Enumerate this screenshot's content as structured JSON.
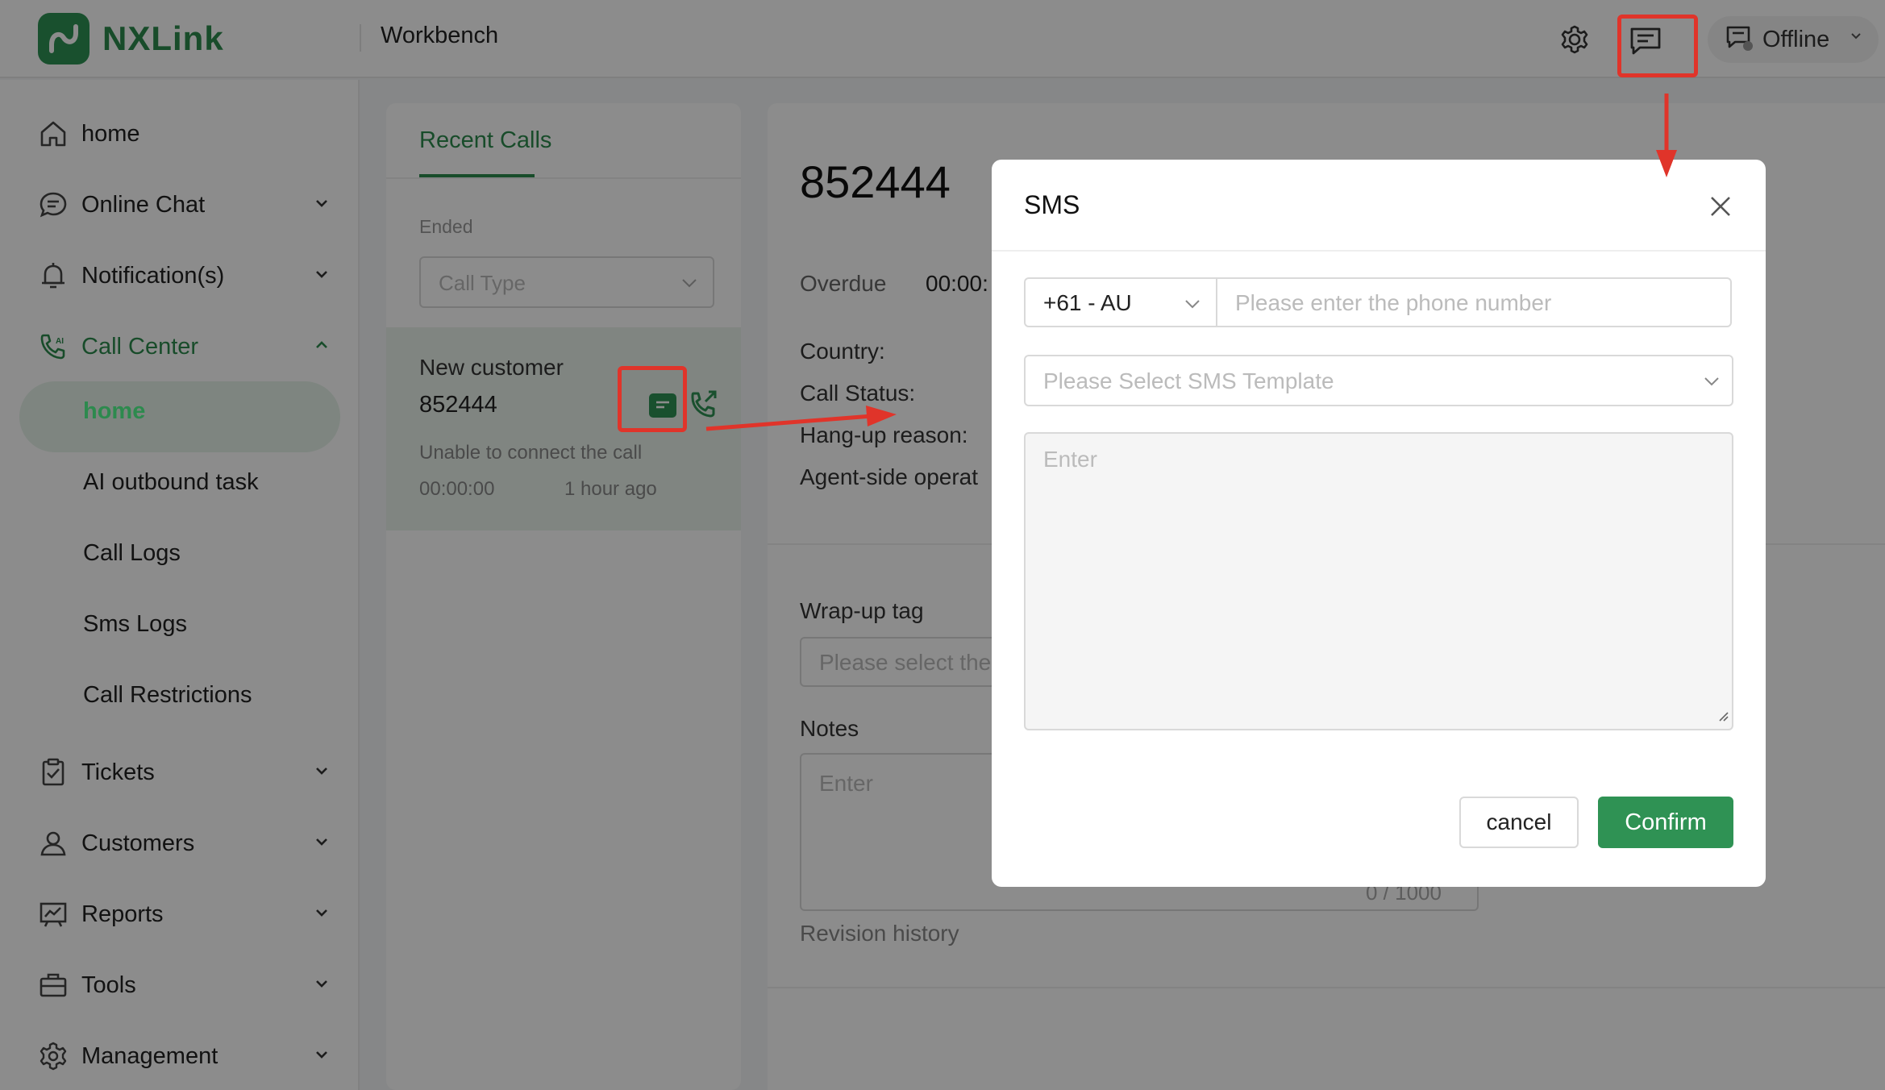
{
  "app": {
    "brand": "NXLink",
    "section_title": "Workbench",
    "brand_color": "#2f9254"
  },
  "topbar": {
    "icons": [
      "gear-icon",
      "message-icon"
    ],
    "status": {
      "label": "Offline",
      "icon": "headset-icon"
    }
  },
  "sidebar": {
    "items": [
      {
        "label": "home",
        "icon": "home-icon"
      },
      {
        "label": "Online Chat",
        "icon": "chat-icon"
      },
      {
        "label": "Notification(s)",
        "icon": "bell-icon"
      },
      {
        "label": "Call Center",
        "icon": "phone-ai-icon"
      },
      {
        "label": "Tickets",
        "icon": "ticket-icon"
      },
      {
        "label": "Customers",
        "icon": "user-icon"
      },
      {
        "label": "Reports",
        "icon": "report-icon"
      },
      {
        "label": "Tools",
        "icon": "toolbox-icon"
      },
      {
        "label": "Management",
        "icon": "settings-icon"
      }
    ],
    "call_center_sub": [
      "home",
      "AI outbound task",
      "Call Logs",
      "Sms Logs",
      "Call Restrictions"
    ],
    "selected_sub": "home"
  },
  "recent_calls": {
    "tab": "Recent Calls",
    "filter_label": "Ended",
    "call_type_placeholder": "Call Type",
    "card": {
      "name": "New customer",
      "number": "852444",
      "status": "Unable to connect the call",
      "duration": "00:00:00",
      "time_ago": "1 hour ago"
    }
  },
  "detail": {
    "number": "852444",
    "overdue_label": "Overdue",
    "overdue_value": "00:00:",
    "country_label": "Country:",
    "call_status_label": "Call Status:",
    "hangup_label": "Hang-up reason:",
    "agent_label": "Agent-side operat",
    "wrapup_label": "Wrap-up tag",
    "wrapup_placeholder": "Please select the",
    "notes_label": "Notes",
    "notes_placeholder": "Enter",
    "notes_counter": "0 / 1000",
    "revision": "Revision history"
  },
  "sms_modal": {
    "title": "SMS",
    "country_code": "+61 - AU",
    "phone_placeholder": "Please enter the phone number",
    "template_placeholder": "Please Select SMS Template",
    "message_placeholder": "Enter",
    "cancel_label": "cancel",
    "confirm_label": "Confirm"
  },
  "annotation_color": "#e0342a"
}
